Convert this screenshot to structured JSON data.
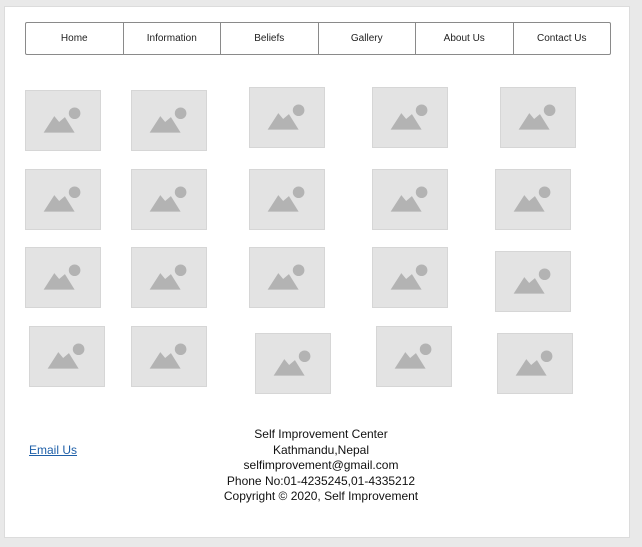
{
  "nav": {
    "items": [
      "Home",
      "Information",
      "Beliefs",
      "Gallery",
      "About Us",
      "Contact Us"
    ]
  },
  "gallery": {
    "icon": "image-placeholder-icon",
    "count": 20,
    "placeholder_color": "#e3e3e3",
    "glyph_color": "#b3b3b3"
  },
  "footer": {
    "email_link": "Email Us",
    "org_name": "Self Improvement Center",
    "location": "Kathmandu,Nepal",
    "email": "selfimprovement@gmail.com",
    "phone": "Phone No:01-4235245,01-4335212",
    "copyright": "Copyright © 2020, Self Improvement"
  }
}
